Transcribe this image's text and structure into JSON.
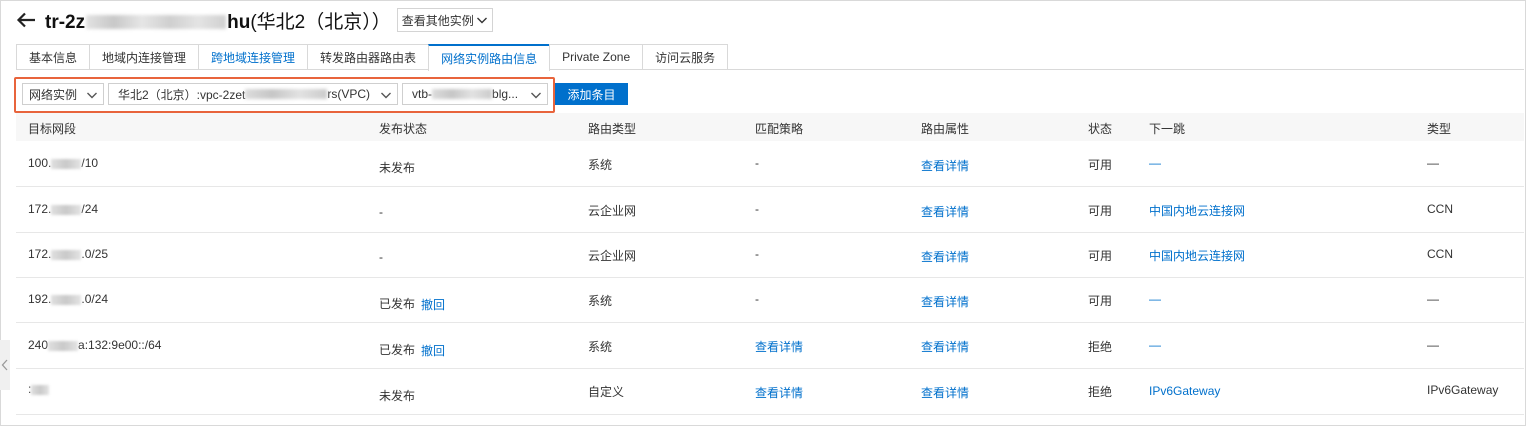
{
  "header": {
    "title_prefix": "tr-2z",
    "title_suffix": "hu",
    "title_region": "(华北2（北京））",
    "other_instances": "查看其他实例"
  },
  "tabs": [
    {
      "label": "基本信息"
    },
    {
      "label": "地域内连接管理"
    },
    {
      "label": "跨地域连接管理"
    },
    {
      "label": "转发路由器路由表"
    },
    {
      "label": "网络实例路由信息"
    },
    {
      "label": "Private Zone"
    },
    {
      "label": "访问云服务"
    }
  ],
  "filters": {
    "type": "网络实例",
    "vpc_prefix": "华北2（北京）:vpc-2zet",
    "vpc_suffix": "rs(VPC)",
    "vtb_prefix": "vtb-",
    "vtb_suffix": "blg...",
    "add_button": "添加条目"
  },
  "columns": [
    "目标网段",
    "发布状态",
    "路由类型",
    "匹配策略",
    "路由属性",
    "状态",
    "下一跳",
    "类型"
  ],
  "rows": [
    {
      "cidr_a": "100.",
      "cidr_b": "/10",
      "publish": "未发布",
      "revoke": "",
      "route_type": "系统",
      "match": "-",
      "attr": "查看详情",
      "status": "可用",
      "next_hop": "—",
      "type": "—"
    },
    {
      "cidr_a": "172.",
      "cidr_b": "/24",
      "publish": "-",
      "revoke": "",
      "route_type": "云企业网",
      "match": "-",
      "attr": "查看详情",
      "status": "可用",
      "next_hop": "中国内地云连接网",
      "type": "CCN"
    },
    {
      "cidr_a": "172.",
      "cidr_b": ".0/25",
      "publish": "-",
      "revoke": "",
      "route_type": "云企业网",
      "match": "-",
      "attr": "查看详情",
      "status": "可用",
      "next_hop": "中国内地云连接网",
      "type": "CCN"
    },
    {
      "cidr_a": "192.",
      "cidr_b": ".0/24",
      "publish": "已发布",
      "revoke": "撤回",
      "route_type": "系统",
      "match": "-",
      "attr": "查看详情",
      "status": "可用",
      "next_hop": "—",
      "type": "—"
    },
    {
      "cidr_a": "240",
      "cidr_b": "a:132:9e00::/64",
      "publish": "已发布",
      "revoke": "撤回",
      "route_type": "系统",
      "match": "查看详情",
      "attr": "查看详情",
      "status": "拒绝",
      "next_hop": "—",
      "type": "—"
    },
    {
      "cidr_a": ":",
      "cidr_b": "",
      "publish": "未发布",
      "revoke": "",
      "route_type": "自定义",
      "match": "查看详情",
      "attr": "查看详情",
      "status": "拒绝",
      "next_hop": "IPv6Gateway",
      "type": "IPv6Gateway"
    }
  ]
}
